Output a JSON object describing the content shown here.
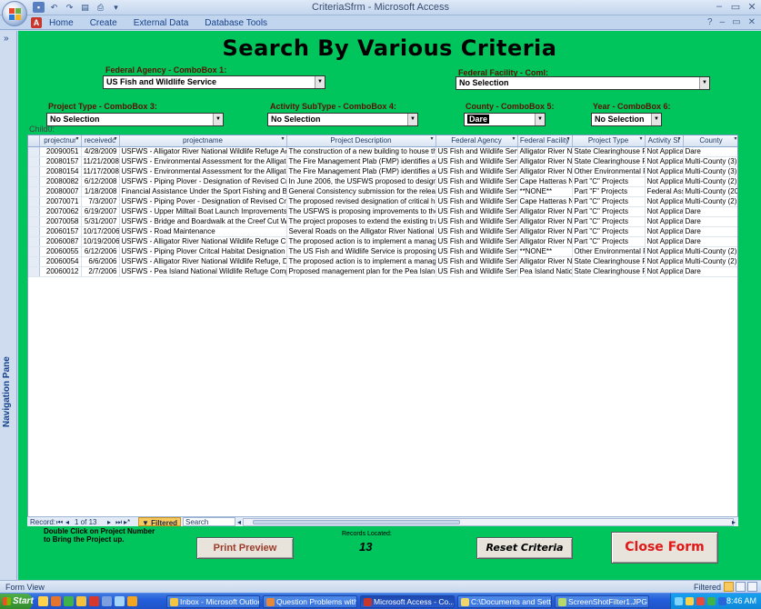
{
  "window": {
    "title": "CriteriaSfrm - Microsoft Access"
  },
  "ribbon": {
    "tabs": [
      "Home",
      "Create",
      "External Data",
      "Database Tools"
    ]
  },
  "nav_pane": {
    "label": "Navigation Pane",
    "toggle": "»"
  },
  "form": {
    "title": "Search By Various Criteria",
    "combos": {
      "federal_agency": {
        "label": "Federal Agency - ComboBox 1:",
        "value": "US Fish and Wildlife Service"
      },
      "federal_facility": {
        "label": "Federal Facility - Coml:",
        "value": "No Selection"
      },
      "project_type": {
        "label": "Project Type - ComboBox 3:",
        "value": "No Selection"
      },
      "activity_subtype": {
        "label": "Activity SubType - ComboBox 4:",
        "value": "No Selection"
      },
      "county": {
        "label": "County - ComboBox 5:",
        "value": "Dare"
      },
      "year": {
        "label": "Year - ComboBox 6:",
        "value": "No Selection"
      }
    },
    "child_label": "Child0:",
    "datasheet": {
      "columns": [
        "projectnur",
        "receivedc",
        "projectname",
        "Project Description",
        "Federal Agency",
        "Federal Facility",
        "Project Type",
        "Activity Si",
        "County"
      ],
      "rows": [
        [
          "20090051",
          "4/28/2009",
          "USFWS - Alligator River National Wildlife Refuge Administr",
          "The construction of a new building to house the ad",
          "US Fish and Wildlife Service",
          "Alligator River Nat",
          "State Clearinghouse Rev",
          "Not Applicab",
          "Dare"
        ],
        [
          "20080157",
          "11/21/2008",
          "USFWS - Environmental Assessment for the Alligator Rive",
          "The Fire Management Plab (FMP) identifies and inte",
          "US Fish and Wildlife Service",
          "Alligator River Nat",
          "State Clearinghouse Rev",
          "Not Applicab",
          "Multi-County (3)"
        ],
        [
          "20080154",
          "11/17/2008",
          "USFWS - Environmental Assessment for the Alligator Rive",
          "The Fire Management Plab (FMP) identifies and inte",
          "US Fish and Wildlife Service",
          "Alligator River Nat",
          "Other Environmental Rev",
          "Not Applicab",
          "Multi-County (3)"
        ],
        [
          "20080082",
          "6/12/2008",
          "USFWS - Piping Plover - Designation of Revised Critical Ha",
          "In June 2006, the USFWS proposed to designate ad",
          "US Fish and Wildlife Service",
          "Cape Hatteras Na",
          "Part \"C\" Projects",
          "Not Applicab",
          "Multi-County (2)"
        ],
        [
          "20080007",
          "1/18/2008",
          "Financial Assistance Under the Sport Fishing and Boating",
          "General Consistency submission for the release of t",
          "US Fish and Wildlife Service",
          "**NONE**",
          "Part \"F\" Projects",
          "Federal Assi",
          "Multi-County (20)"
        ],
        [
          "20070071",
          "7/3/2007",
          "USFWS - Piping Pover - Designation of Revised Critical Ha",
          "The proposed revised designation of critical habita",
          "US Fish and Wildlife Service",
          "Cape Hatteras Na",
          "Part \"C\" Projects",
          "Not Applicab",
          "Multi-County (2)"
        ],
        [
          "20070062",
          "6/19/2007",
          "USFWS - Upper Milltail Boat Launch Improvements",
          "The USFWS is proposing improvements to the Uppe",
          "US Fish and Wildlife Service",
          "Alligator River Nat",
          "Part \"C\" Projects",
          "Not Applicab",
          "Dare"
        ],
        [
          "20070058",
          "5/31/2007",
          "USFWS - Bridge and Boardwalk at the Creef Cut Wildlife T",
          "The project proposes to extend the existing trail by",
          "US Fish and Wildlife Service",
          "Alligator River Nat",
          "Part \"C\" Projects",
          "Not Applicab",
          "Dare"
        ],
        [
          "20060157",
          "10/17/2006",
          "USFWS - Road Maintenance",
          "Several Roads on the Alligator River National Wildli",
          "US Fish and Wildlife Service",
          "Alligator River Nat",
          "Part \"C\" Projects",
          "Not Applicab",
          "Dare"
        ],
        [
          "20060087",
          "10/19/2006",
          "USFWS - Alligator River National Wildlife Refuge Comprehe",
          "The proposed action is to implement a management",
          "US Fish and Wildlife Service",
          "Alligator River Nat",
          "Part \"C\" Projects",
          "Not Applicab",
          "Dare"
        ],
        [
          "20060055",
          "6/12/2006",
          "USFWS - Piping Plover Critcal Habitat Designation",
          "The US Fish and Wildlife Service is proposing to de",
          "US Fish and Wildlife Service",
          "**NONE**",
          "Other Environmental Rev",
          "Not Applicab",
          "Multi-County (2)"
        ],
        [
          "20060054",
          "6/6/2006",
          "USFWS - Alligator River National Wildlife Refuge, Draft Co",
          "The proposed action is to implement a management",
          "US Fish and Wildlife Service",
          "Alligator River Nat",
          "State Clearinghouse Rev",
          "Not Applicab",
          "Multi-County (2)"
        ],
        [
          "20060012",
          "2/7/2006",
          "USFWS - Pea Island National Wildlife Refuge Comprehens",
          "Proposed management plan for the Pea Island Natio",
          "US Fish and Wildlife Service",
          "Pea Island Nationa",
          "State Clearinghouse Rev",
          "Not Applicab",
          "Dare"
        ]
      ]
    },
    "record_nav": {
      "label": "Record:",
      "position": "1 of 13",
      "filtered": "Filtered",
      "search": "Search"
    },
    "hint": "Double Click on Project Number\nto Bring the Project up.",
    "records_label": "Records Located:",
    "records_count": "13",
    "buttons": {
      "print": "Print Preview",
      "reset": "Reset Criteria",
      "close": "Close Form"
    }
  },
  "status": {
    "left": "Form View",
    "right": "Filtered"
  },
  "taskbar": {
    "start": "Start",
    "items": [
      "Inbox - Microsoft Outlook",
      "Question Problems with s...",
      "Microsoft Access - Co...",
      "C:\\Documents and Settin...",
      "ScreenShotFilter1.JPG - ..."
    ],
    "clock": "8:46 AM"
  }
}
